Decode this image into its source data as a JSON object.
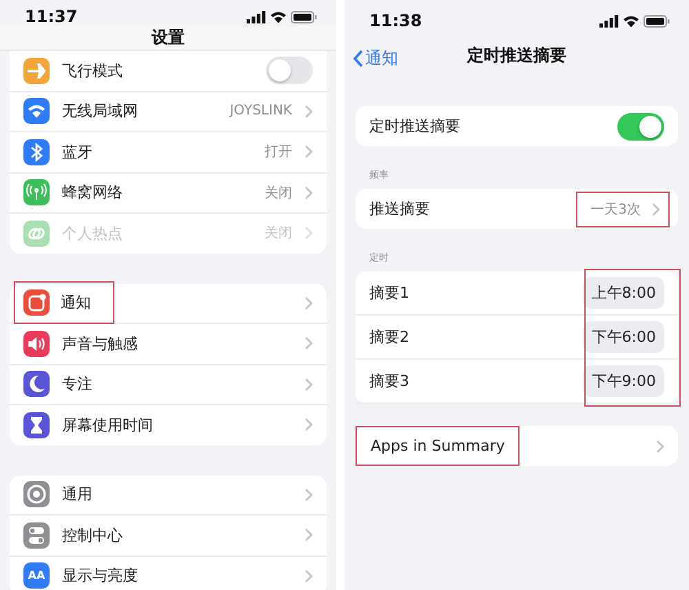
{
  "settings_screen": {
    "status_bar": {
      "time": "11:37"
    },
    "title": "设置",
    "groups": [
      {
        "rows": [
          {
            "label": "飞行模式",
            "color": "#f2a33a",
            "kind": "toggle",
            "on": false,
            "disabled": false,
            "highlighted": false
          },
          {
            "label": "无线局域网",
            "color": "#2f7cf6",
            "kind": "link",
            "value": "JOYSLINK",
            "disabled": false,
            "highlighted": false
          },
          {
            "label": "蓝牙",
            "color": "#2f7cf6",
            "kind": "link",
            "value": "打开",
            "disabled": false,
            "highlighted": false
          },
          {
            "label": "蜂窝网络",
            "color": "#3cbf5a",
            "kind": "link",
            "value": "关闭",
            "disabled": false,
            "highlighted": false
          },
          {
            "label": "个人热点",
            "color": "#a8e0b4",
            "kind": "link",
            "value": "关闭",
            "disabled": true,
            "highlighted": false
          }
        ]
      },
      {
        "rows": [
          {
            "label": "通知",
            "color": "#eb4d3d",
            "kind": "link",
            "disabled": false,
            "highlighted": true
          },
          {
            "label": "声音与触感",
            "color": "#eb3b5a",
            "kind": "link",
            "disabled": false,
            "highlighted": false
          },
          {
            "label": "专注",
            "color": "#5a55d6",
            "kind": "link",
            "disabled": false,
            "highlighted": false
          },
          {
            "label": "屏幕使用时间",
            "color": "#5a55d6",
            "kind": "link",
            "disabled": false,
            "highlighted": false
          }
        ]
      },
      {
        "rows": [
          {
            "label": "通用",
            "color": "#8e8e93",
            "kind": "link",
            "disabled": false,
            "highlighted": false
          },
          {
            "label": "控制中心",
            "color": "#8e8e93",
            "kind": "link",
            "disabled": false,
            "highlighted": false
          },
          {
            "label": "显示与亮度",
            "color": "#2f7cf6",
            "kind": "link",
            "icon_text": "AA",
            "disabled": false,
            "highlighted": false
          }
        ]
      }
    ]
  },
  "summary_screen": {
    "status_bar": {
      "time": "11:38"
    },
    "back": "通知",
    "title": "定时推送摘要",
    "sections": [
      {
        "rows": [
          {
            "kind": "toggle",
            "label": "定时推送摘要",
            "on": true
          }
        ]
      },
      {
        "header": "频率",
        "rows": [
          {
            "kind": "value",
            "label": "推送摘要",
            "value": "一天3次",
            "highlighted": true
          }
        ]
      },
      {
        "header": "定时",
        "highlighted": true,
        "rows": [
          {
            "kind": "time",
            "label": "摘要1",
            "value": "上午8:00"
          },
          {
            "kind": "time",
            "label": "摘要2",
            "value": "下午6:00"
          },
          {
            "kind": "time",
            "label": "摘要3",
            "value": "下午9:00"
          }
        ]
      },
      {
        "rows": [
          {
            "kind": "link",
            "label": "Apps in Summary",
            "highlighted": true
          }
        ]
      }
    ]
  }
}
